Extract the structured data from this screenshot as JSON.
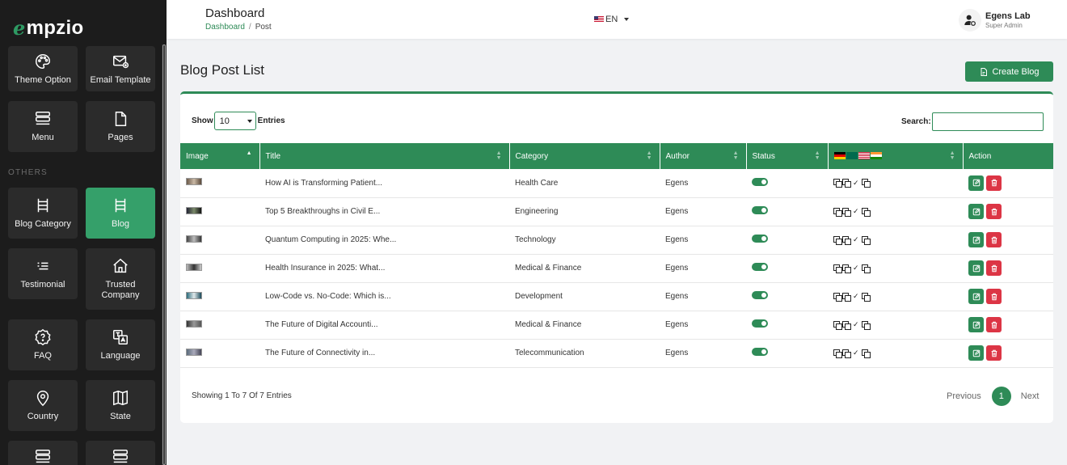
{
  "brand": {
    "logo_mark": "e",
    "logo_text": "mpzio"
  },
  "sidebar": {
    "section_label": "OTHERS",
    "tiles_top": [
      {
        "label": "Theme Option",
        "icon": "palette-icon"
      },
      {
        "label": "Email Template",
        "icon": "email-template-icon"
      },
      {
        "label": "Menu",
        "icon": "menu-icon"
      },
      {
        "label": "Pages",
        "icon": "page-icon"
      }
    ],
    "tiles_others": [
      {
        "label": "Blog Category",
        "icon": "list-icon"
      },
      {
        "label": "Blog",
        "icon": "list-icon",
        "active": true
      },
      {
        "label": "Testimonial",
        "icon": "testimonial-icon"
      },
      {
        "label": "Trusted Company",
        "icon": "home-icon"
      },
      {
        "label": "FAQ",
        "icon": "faq-icon"
      },
      {
        "label": "Language",
        "icon": "translate-icon"
      },
      {
        "label": "Country",
        "icon": "location-icon"
      },
      {
        "label": "State",
        "icon": "map-icon"
      }
    ]
  },
  "header": {
    "title": "Dashboard",
    "breadcrumb": {
      "home": "Dashboard",
      "separator": "/",
      "current": "Post"
    },
    "language": "EN",
    "user": {
      "name": "Egens Lab",
      "role": "Super Admin"
    }
  },
  "page": {
    "title": "Blog Post List",
    "create_button": "Create Blog",
    "show_label": "Show",
    "entries_label": "Entries",
    "page_size": "10",
    "search_label": "Search:",
    "search_value": "",
    "columns": [
      "Image",
      "Title",
      "Category",
      "Author",
      "Status",
      "",
      "Action"
    ],
    "rows": [
      {
        "title": "How AI is Transforming Patient...",
        "category": "Health Care",
        "author": "Egens",
        "status": true
      },
      {
        "title": "Top 5 Breakthroughs in Civil E...",
        "category": "Engineering",
        "author": "Egens",
        "status": true
      },
      {
        "title": "Quantum Computing in 2025: Whe...",
        "category": "Technology",
        "author": "Egens",
        "status": true
      },
      {
        "title": "Health Insurance in 2025: What...",
        "category": "Medical & Finance",
        "author": "Egens",
        "status": true
      },
      {
        "title": "Low-Code vs. No-Code: Which is...",
        "category": "Development",
        "author": "Egens",
        "status": true
      },
      {
        "title": "The Future of Digital Accounti...",
        "category": "Medical & Finance",
        "author": "Egens",
        "status": true
      },
      {
        "title": "The Future of Connectivity in...",
        "category": "Telecommunication",
        "author": "Egens",
        "status": true
      }
    ],
    "showing_text": "Showing 1 To 7 Of 7 Entries",
    "pagination": {
      "previous": "Previous",
      "current": "1",
      "next": "Next"
    }
  },
  "colors": {
    "primary": "#2e8b57",
    "danger": "#dc3545",
    "sidebar_bg": "#1c1c1c",
    "active_tile": "#35a06a"
  }
}
